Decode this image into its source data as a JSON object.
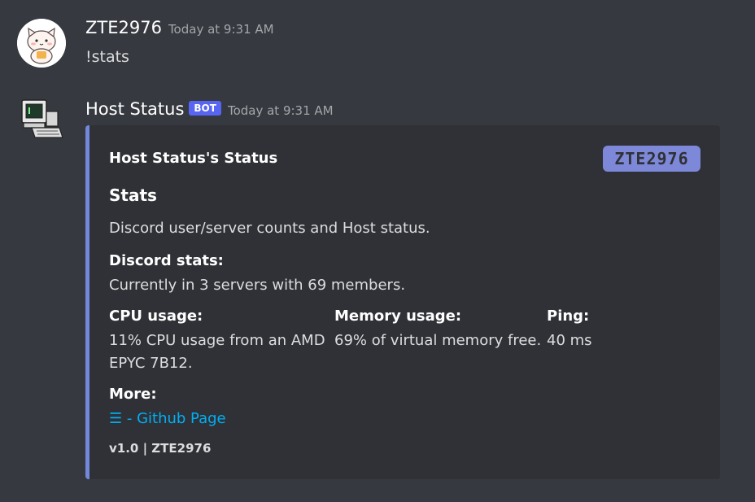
{
  "messages": [
    {
      "username": "ZTE2976",
      "timestamp": "Today at 9:31 AM",
      "content": "!stats"
    },
    {
      "username": "Host Status",
      "badge": "BOT",
      "timestamp": "Today at 9:31 AM",
      "embed": {
        "author": "Host Status's Status",
        "thumbnail_text": "ZTE2976",
        "title": "Stats",
        "description": "Discord user/server counts and Host status.",
        "fields": [
          {
            "name": "Discord stats:",
            "value": "Currently in 3 servers with 69 members."
          },
          {
            "name": "CPU usage:",
            "value": "11% CPU usage from an AMD EPYC 7B12."
          },
          {
            "name": "Memory usage:",
            "value": "69% of virtual memory free."
          },
          {
            "name": "Ping:",
            "value": "40 ms"
          },
          {
            "name": "More:",
            "value": "☰ - Github Page"
          }
        ],
        "footer": "v1.0  |  ZTE2976"
      }
    }
  ],
  "colors": {
    "background": "#36393f",
    "embed_bg": "#2f3136",
    "embed_accent": "#7289da",
    "bot_badge": "#5865f2",
    "link": "#00aff4"
  }
}
